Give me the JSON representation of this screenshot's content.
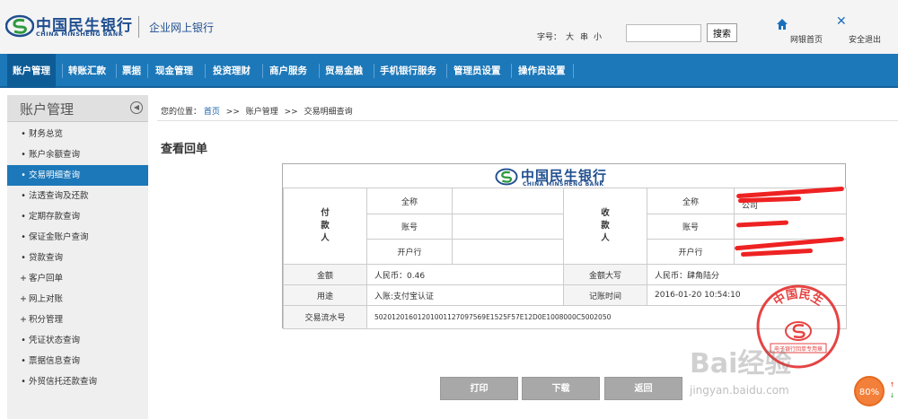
{
  "header": {
    "logo_cn": "中国民生银行",
    "logo_en": "CHINA MINSHENG BANK",
    "site_title": "企业网上银行",
    "font_size_label": "字号：",
    "font_size_options": [
      "大",
      "串",
      "小"
    ],
    "search_value": "",
    "search_button": "搜索",
    "home_link": "网银首页",
    "home_icon": "home-icon",
    "exit_link": "安全退出",
    "exit_icon": "close-icon"
  },
  "nav": {
    "items": [
      {
        "label": "账户管理",
        "active": true
      },
      {
        "label": "转账汇款"
      },
      {
        "label": "票据"
      },
      {
        "label": "现金管理"
      },
      {
        "label": "投资理财"
      },
      {
        "label": "商户服务"
      },
      {
        "label": "贸易金融"
      },
      {
        "label": "手机银行服务"
      },
      {
        "label": "管理员设置"
      },
      {
        "label": "操作员设置"
      }
    ]
  },
  "sidebar": {
    "title": "账户管理",
    "collapse_icon": "collapse-icon",
    "items": [
      {
        "marker": "•",
        "label": "财务总览"
      },
      {
        "marker": "•",
        "label": "账户余额查询"
      },
      {
        "marker": "•",
        "label": "交易明细查询",
        "active": true
      },
      {
        "marker": "•",
        "label": "法透查询及还款"
      },
      {
        "marker": "•",
        "label": "定期存款查询"
      },
      {
        "marker": "•",
        "label": "保证金账户查询"
      },
      {
        "marker": "•",
        "label": "贷款查询"
      },
      {
        "marker": "+",
        "label": "客户回单"
      },
      {
        "marker": "+",
        "label": "网上对账"
      },
      {
        "marker": "+",
        "label": "积分管理"
      },
      {
        "marker": "•",
        "label": "凭证状态查询"
      },
      {
        "marker": "•",
        "label": "票据信息查询"
      },
      {
        "marker": "•",
        "label": "外贸信托还款查询"
      }
    ]
  },
  "breadcrumb": {
    "prefix": "您的位置：",
    "home": "首页",
    "sep": ">>",
    "level1": "账户管理",
    "level2": "交易明细查询"
  },
  "page_title": "查看回单",
  "receipt": {
    "bank_cn": "中国民生银行",
    "bank_en": "CHINA MINSHENG BANK",
    "payer_label": [
      "付",
      "款",
      "人"
    ],
    "payee_label": [
      "收",
      "款",
      "人"
    ],
    "full_name_label": "全称",
    "account_label": "账号",
    "bank_label": "开户行",
    "payer_full_name": "",
    "payer_account": "",
    "payer_bank": "",
    "payee_full_name": "公司",
    "amount_label": "金额",
    "amount_value": "人民币：0.46",
    "amount_upper_label": "金额大写",
    "amount_upper_value": "人民币：肆角陆分",
    "purpose_label": "用途",
    "purpose_value": "入账:支付宝认证",
    "time_label": "记账时间",
    "time_value": "2016-01-20 10:54:10",
    "serial_label": "交易流水号",
    "serial_value": "50201201601201001127097569E1525F57E12D0E1008000C5002050",
    "stamp_text_top": "中国民生",
    "stamp_text_bottom": "电子银行回单专用章"
  },
  "actions": {
    "print": "打印",
    "download": "下载",
    "back": "返回"
  },
  "watermark": {
    "main": "Bai经验",
    "sub": "jingyan.baidu.com"
  },
  "zoom": {
    "level": "80%"
  },
  "colors": {
    "brand_blue": "#1c78b9",
    "logo_blue": "#1f4e8f",
    "logo_green": "#2e9a3e",
    "stamp_red": "#e22222",
    "button_gray": "#a8a8a8",
    "zoom_orange": "#f3803a"
  }
}
